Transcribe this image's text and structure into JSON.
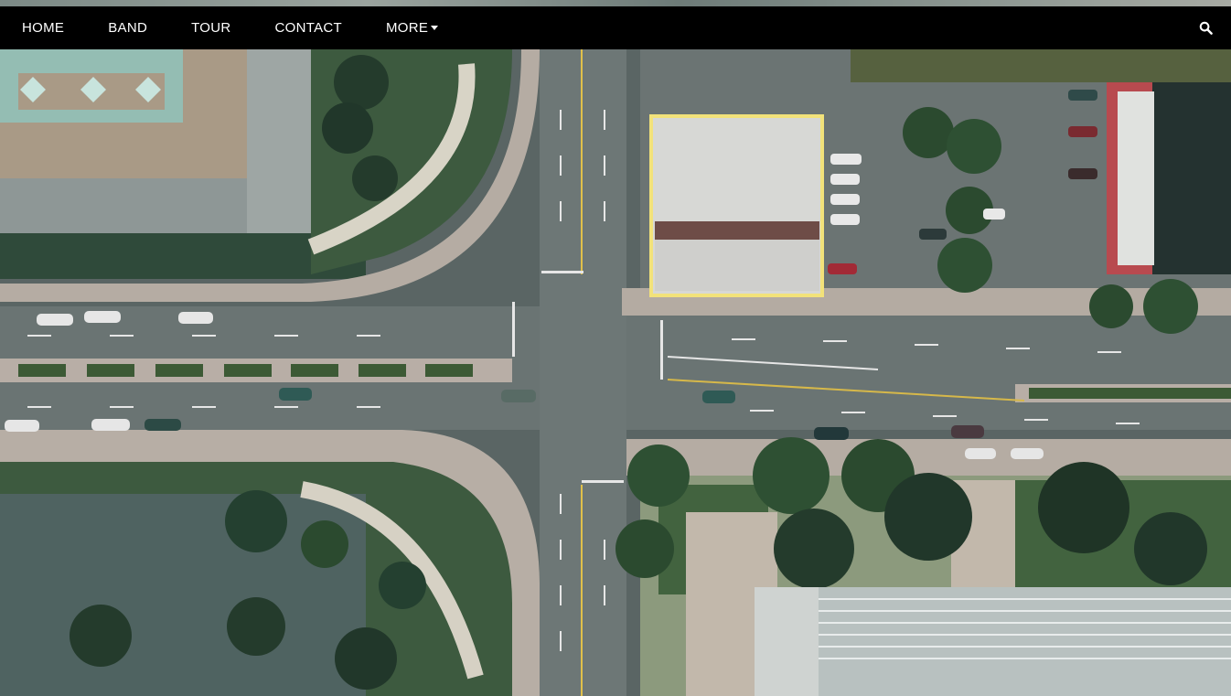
{
  "navbar": {
    "items": [
      {
        "label": "HOME"
      },
      {
        "label": "BAND"
      },
      {
        "label": "TOUR"
      },
      {
        "label": "CONTACT"
      },
      {
        "label": "MORE"
      }
    ],
    "search_icon": "search-icon",
    "more_icon": "caret-down-icon",
    "background": "#000000",
    "text_color": "#ffffff"
  },
  "hero": {
    "image": "aerial-city-intersection",
    "highlight_color": "#f2e27a"
  }
}
